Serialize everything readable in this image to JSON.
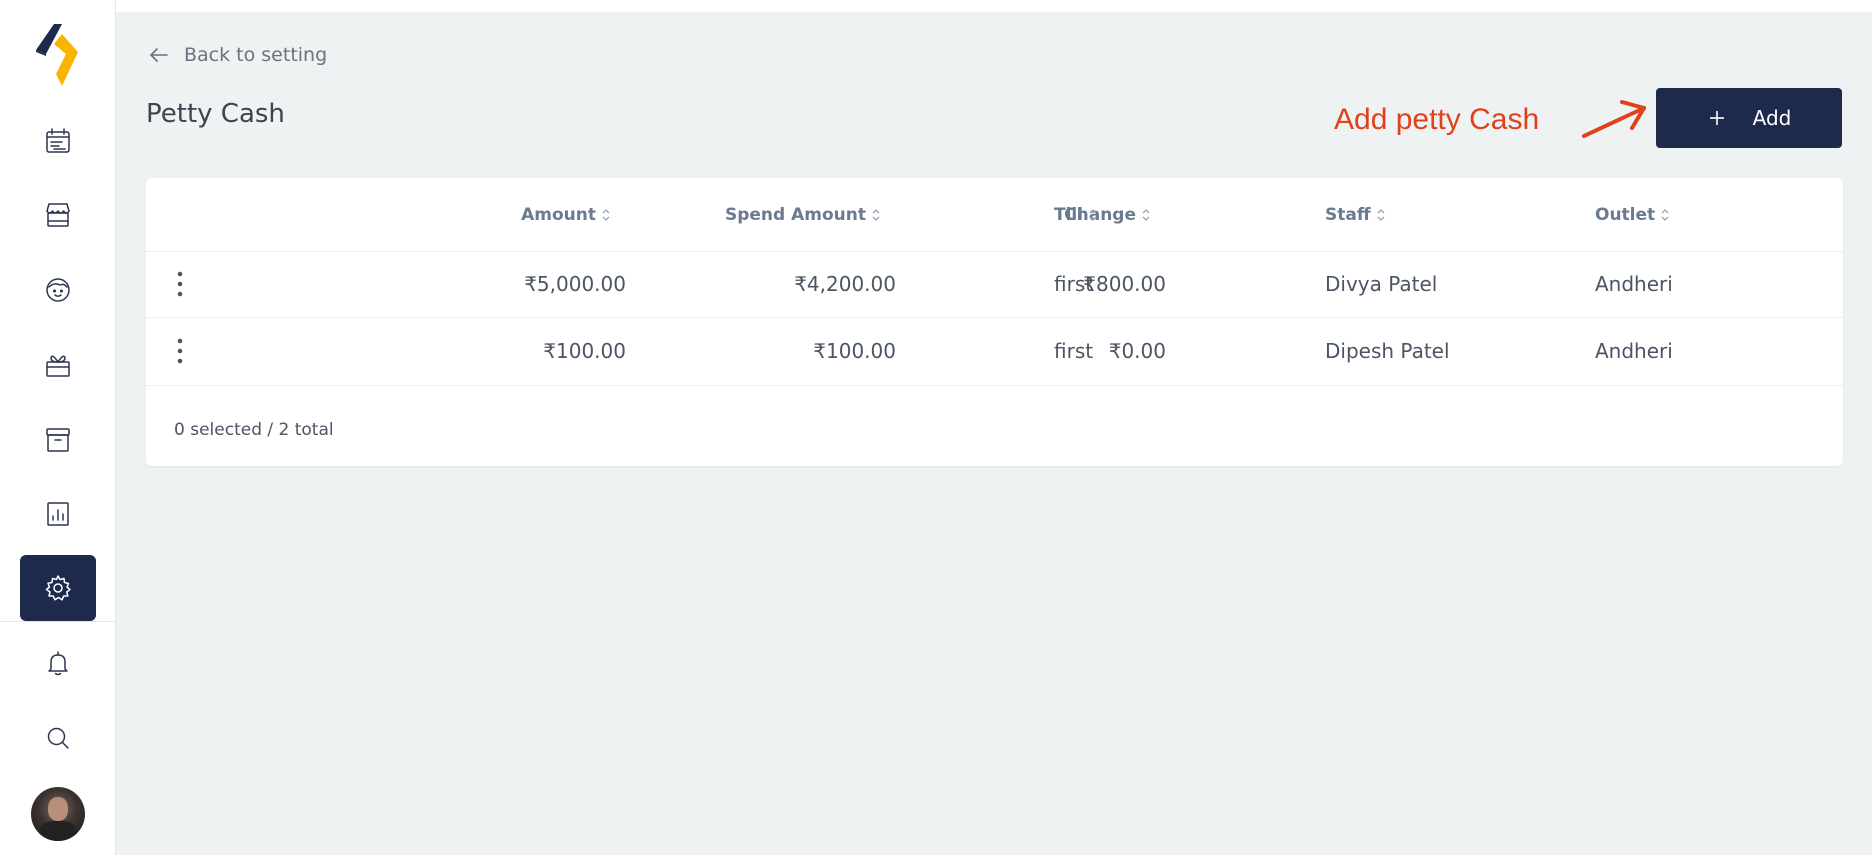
{
  "nav": {
    "back_label": "Back to setting"
  },
  "page": {
    "title": "Petty Cash"
  },
  "annotation": {
    "text": "Add petty Cash",
    "color": "#e0411a"
  },
  "toolbar": {
    "add_label": "Add"
  },
  "table": {
    "columns": [
      "Amount",
      "Spend Amount",
      "Change",
      "Till",
      "Staff",
      "Outlet"
    ],
    "rows": [
      {
        "amount": "₹5,000.00",
        "spend_amount": "₹4,200.00",
        "change": "₹800.00",
        "till": "first",
        "staff": "Divya Patel",
        "outlet": "Andheri"
      },
      {
        "amount": "₹100.00",
        "spend_amount": "₹100.00",
        "change": "₹0.00",
        "till": "first",
        "staff": "Dipesh Patel",
        "outlet": "Andheri"
      }
    ],
    "footer": "0 selected / 2 total"
  },
  "sidebar": {
    "items": [
      {
        "icon": "calendar-icon",
        "active": false
      },
      {
        "icon": "store-icon",
        "active": false
      },
      {
        "icon": "customer-face-icon",
        "active": false
      },
      {
        "icon": "gift-icon",
        "active": false
      },
      {
        "icon": "archive-icon",
        "active": false
      },
      {
        "icon": "report-chart-icon",
        "active": false
      },
      {
        "icon": "gear-icon",
        "active": true
      },
      {
        "icon": "bell-icon",
        "active": false
      },
      {
        "icon": "search-icon",
        "active": false
      }
    ]
  },
  "colors": {
    "brand_navy": "#1d2a4d",
    "logo_yellow": "#f7b500",
    "background": "#eff2f3"
  }
}
